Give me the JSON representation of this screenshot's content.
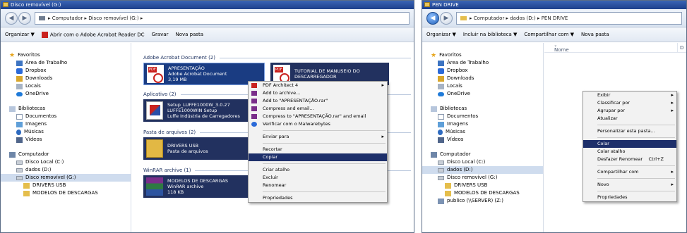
{
  "left_window": {
    "title": "Disco removível (G:)",
    "breadcrumb": "▸ Computador ▸ Disco removível (G:) ▸",
    "toolbar": [
      "Organizar ▼",
      "Abrir com o Adobe Acrobat Reader DC",
      "Gravar",
      "Nova pasta"
    ],
    "nav": {
      "favorites_label": "Favoritos",
      "favorites": [
        "Área de Trabalho",
        "Dropbox",
        "Downloads",
        "Locais",
        "OneDrive"
      ],
      "libraries_label": "Bibliotecas",
      "libraries": [
        "Documentos",
        "Imagens",
        "Músicas",
        "Vídeos"
      ],
      "computer_label": "Computador",
      "drives": [
        "Disco Local (C:)",
        "dados (D:)",
        "Disco removível (G:)"
      ],
      "subfolders": [
        "DRIVERS USB",
        "MODELOS DE DESCARGAS"
      ]
    },
    "groups": {
      "g1": "Adobe Acrobat Document (2)",
      "g2": "Aplicativo (2)",
      "g3": "Pasta de arquivos (2)",
      "g4": "WinRAR archive (1)"
    },
    "files": {
      "f1": {
        "name": "APRESENTAÇÃO",
        "type": "Adobe Acrobat Document",
        "size": "3,19 MB"
      },
      "f2": {
        "name": "TUTORIAL DE MANUSEIO DO",
        "type": "DESCARREGADOR"
      },
      "f3": {
        "name": "Setup_LUFFE1000W_3.0.27",
        "type": "LUFFE1000WIN Setup",
        "size": "Luffe Indústria de Carregadores"
      },
      "f4": {
        "name": "DRIVERS USB",
        "type": "Pasta de arquivos"
      },
      "f5": {
        "name": "MODELOS DE DESCARGAS",
        "type": "WinRAR archive",
        "size": "118 KB"
      }
    },
    "context_menu": {
      "items": [
        "PDF Architect 4",
        "Add to archive...",
        "Add to \"APRESENTAÇÃO.rar\"",
        "Compress and email...",
        "Compress to \"APRESENTAÇÃO.rar\" and email",
        "Verificar com o Malwarebytes"
      ],
      "send_to": "Enviar para",
      "cut": "Recortar",
      "copy": "Copiar",
      "shortcut": "Criar atalho",
      "delete": "Excluir",
      "rename": "Renomear",
      "properties": "Propriedades"
    }
  },
  "right_window": {
    "title": "PEN DRIVE",
    "breadcrumb": "▸ Computador ▸ dados (D:) ▸ PEN DRIVE",
    "toolbar": [
      "Organizar ▼",
      "Incluir na biblioteca ▼",
      "Compartilhar com ▼",
      "Nova pasta"
    ],
    "column_name": "Nome",
    "column_d": "D",
    "nav": {
      "favorites_label": "Favoritos",
      "favorites": [
        "Área de Trabalho",
        "Dropbox",
        "Downloads",
        "Locais",
        "OneDrive"
      ],
      "libraries_label": "Bibliotecas",
      "libraries": [
        "Documentos",
        "Imagens",
        "Músicas",
        "Vídeos"
      ],
      "computer_label": "Computador",
      "drives": [
        "Disco Local (C:)",
        "dados (D:)",
        "Disco removível (G:)"
      ],
      "subfolders": [
        "DRIVERS USB",
        "MODELOS DE DESCARGAS"
      ],
      "network": "publico (\\\\SERVER) (Z:)"
    },
    "context_menu": {
      "view": "Exibir",
      "sort": "Classificar por",
      "group": "Agrupar por",
      "refresh": "Atualizar",
      "customize": "Personalizar esta pasta...",
      "paste": "Colar",
      "paste_shortcut": "Colar atalho",
      "undo": "Desfazer Renomear",
      "undo_key": "Ctrl+Z",
      "share": "Compartilhar com",
      "new": "Novo",
      "properties": "Propriedades"
    }
  }
}
